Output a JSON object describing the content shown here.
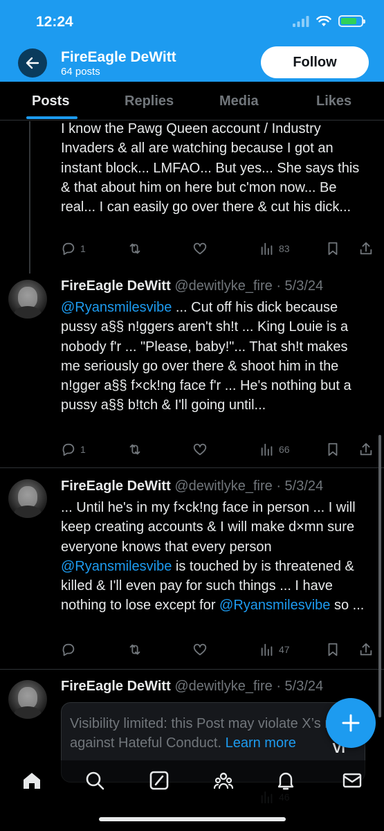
{
  "status_bar": {
    "time": "12:24"
  },
  "profile": {
    "name": "FireEagle DeWitt",
    "posts_count": "64 posts",
    "follow_label": "Follow"
  },
  "tabs": [
    {
      "label": "Posts",
      "active": true
    },
    {
      "label": "Replies",
      "active": false
    },
    {
      "label": "Media",
      "active": false
    },
    {
      "label": "Likes",
      "active": false
    }
  ],
  "posts": [
    {
      "text": "I know the Pawg Queen account / Industry Invaders & all are watching because I got an instant block... LMFAO... But yes... She says this & that about him on here but c'mon now... Be real... I can easily go over there & cut his dick...",
      "replies": "1",
      "views": "83"
    },
    {
      "author": "FireEagle DeWitt",
      "handle": "@dewitlyke_fire · 5/3/24",
      "mention": "@Ryansmilesvibe",
      "text": " ... Cut off his dick because pussy a§§ n!ggers aren't sh!t ... King Louie is a nobody f'r ... \"Please, baby!\"... That sh!t makes me seriously go over there & shoot him in the n!gger a§§ f×ck!ng face f'r ... He's nothing but a pussy a§§ b!tch & I'll going until...",
      "replies": "1",
      "views": "66"
    },
    {
      "author": "FireEagle DeWitt",
      "handle": "@dewitlyke_fire · 5/3/24",
      "text_a": "... Until he's in my f×ck!ng face in person ... I will keep creating accounts & I will make d×mn sure everyone knows that every person ",
      "mention": "@Ryansmilesvibe",
      "text_b": " is touched by is threatened & killed & I'll even pay for such things ... I have nothing to lose except for ",
      "mention_2": "@Ryansmilesvibe",
      "text_c": " so ...",
      "views": "47"
    },
    {
      "author": "FireEagle DeWitt",
      "handle": "@dewitlyke_fire · 5/3/24",
      "notice_text": "Visibility limited: this Post may violate X’s rules against Hateful Conduct. ",
      "notice_link": "Learn more",
      "notice_view": "Vi",
      "views": "46"
    }
  ],
  "colors": {
    "brand": "#1d9bf0",
    "background": "#000000",
    "muted": "#71767b"
  }
}
